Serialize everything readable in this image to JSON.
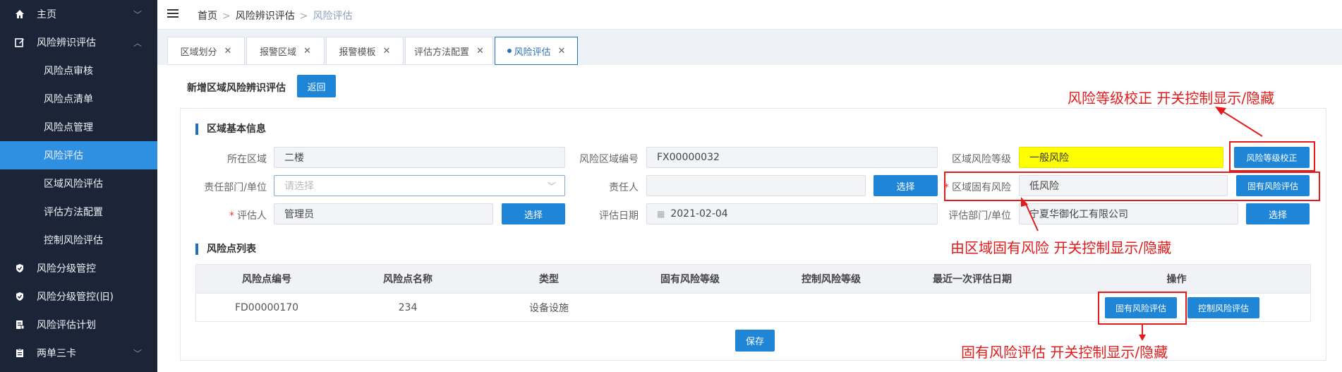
{
  "sidebar": {
    "items": [
      {
        "label": "主页",
        "icon": "home-icon"
      },
      {
        "label": "风险辨识评估",
        "icon": "edit-icon"
      },
      {
        "label": "风险点审核"
      },
      {
        "label": "风险点清单"
      },
      {
        "label": "风险点管理"
      },
      {
        "label": "风险评估"
      },
      {
        "label": "区域风险评估"
      },
      {
        "label": "评估方法配置"
      },
      {
        "label": "控制风险评估"
      },
      {
        "label": "风险分级管控",
        "icon": "shield-icon"
      },
      {
        "label": "风险分级管控(旧)",
        "icon": "shield-icon"
      },
      {
        "label": "风险评估计划",
        "icon": "document-icon"
      },
      {
        "label": "两单三卡",
        "icon": "clipboard-icon"
      }
    ]
  },
  "breadcrumb": {
    "home": "首页",
    "level1": "风险辨识评估",
    "current": "风险评估"
  },
  "tabs": [
    {
      "label": "区域划分"
    },
    {
      "label": "报警区域"
    },
    {
      "label": "报警模板"
    },
    {
      "label": "评估方法配置"
    },
    {
      "label": "风险评估"
    }
  ],
  "page": {
    "title": "新增区域风险辨识评估",
    "back_label": "返回",
    "section_basic": "区域基本信息",
    "section_list": "风险点列表",
    "save_label": "保存"
  },
  "form": {
    "area_label": "所在区域",
    "area_value": "二楼",
    "code_label": "风险区域编号",
    "code_value": "FX00000032",
    "level_label": "区域风险等级",
    "level_value": "一般风险",
    "level_btn": "风险等级校正",
    "dept_label": "责任部门/单位",
    "dept_placeholder": "请选择",
    "owner_label": "责任人",
    "owner_value": "",
    "owner_btn": "选择",
    "inherent_label": "区域固有风险",
    "inherent_value": "低风险",
    "inherent_btn": "固有风险评估",
    "assessor_label": "评估人",
    "assessor_value": "管理员",
    "assessor_btn": "选择",
    "date_label": "评估日期",
    "date_value": "2021-02-04",
    "assess_dept_label": "评估部门/单位",
    "assess_dept_value": "宁夏华御化工有限公司",
    "assess_dept_btn": "选择"
  },
  "table": {
    "headers": [
      "风险点编号",
      "风险点名称",
      "类型",
      "固有风险等级",
      "控制风险等级",
      "最近一次评估日期",
      "操作"
    ],
    "rows": [
      {
        "code": "FD00000170",
        "name": "234",
        "type": "设备设施",
        "inherent": "",
        "control": "",
        "date": "",
        "btn1": "固有风险评估",
        "btn2": "控制风险评估"
      }
    ]
  },
  "annotations": {
    "a1": "风险等级校正 开关控制显示/隐藏",
    "a2": "由区域固有风险 开关控制显示/隐藏",
    "a3": "固有风险评估 开关控制显示/隐藏"
  },
  "colors": {
    "accent": "#1f85d6",
    "sidebar": "#1c2537",
    "highlight": "#ffff00",
    "annotation": "#e31b1b"
  }
}
